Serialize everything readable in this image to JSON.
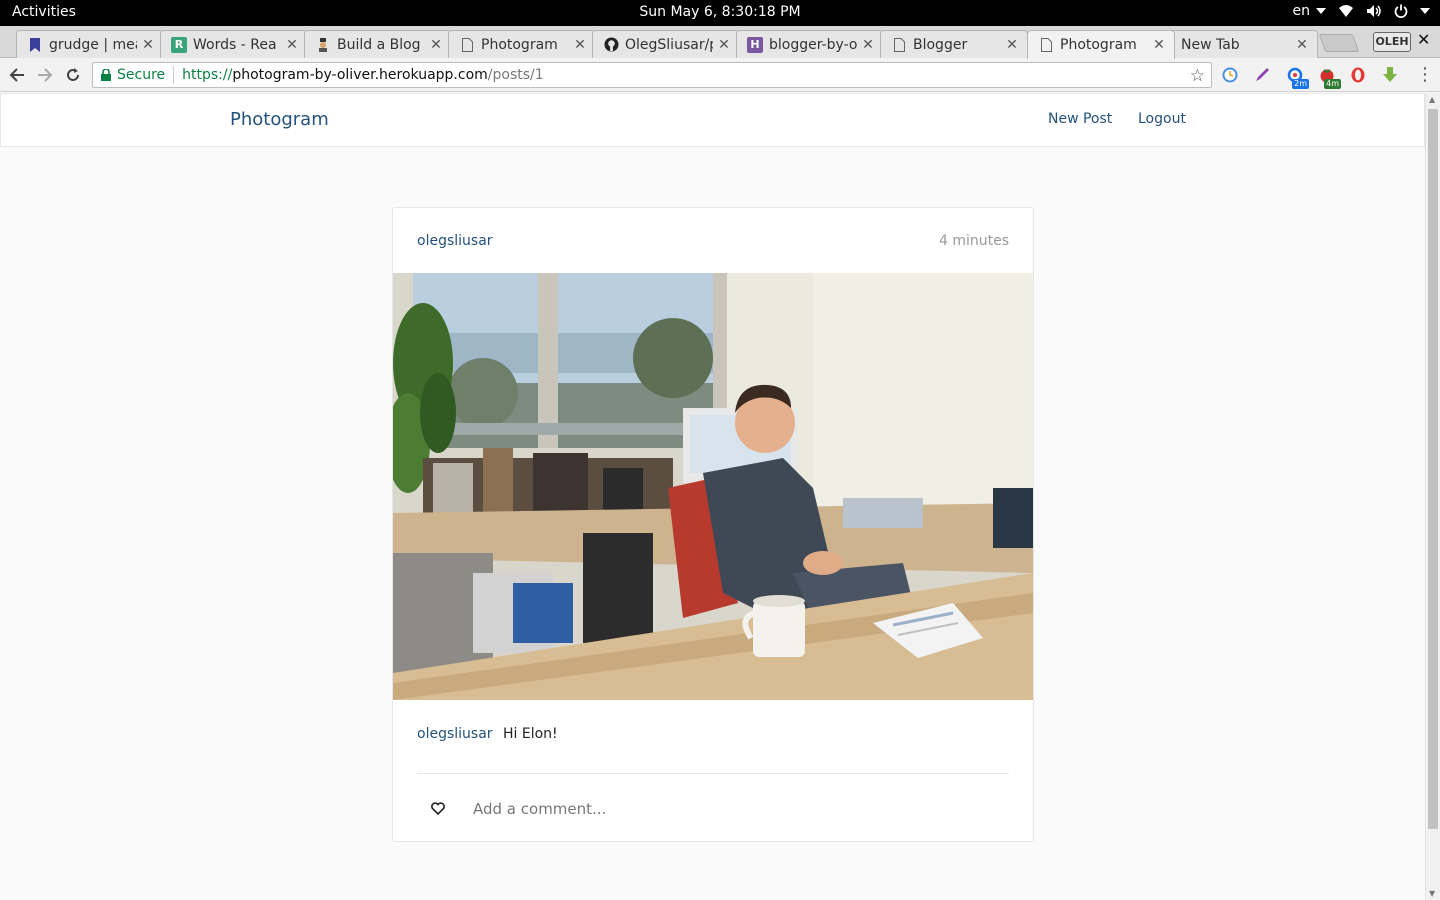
{
  "system_bar": {
    "activities": "Activities",
    "clock": "Sun May  6,  8:30:18 PM",
    "language": "en"
  },
  "browser": {
    "tabs": [
      {
        "title": "grudge | mea",
        "icon": "bookmark-icon",
        "active": false
      },
      {
        "title": "Words - Rea",
        "icon": "r-logo-icon",
        "active": false
      },
      {
        "title": "Build a Blog ",
        "icon": "gentleman-icon",
        "active": false
      },
      {
        "title": "Photogram",
        "icon": "page-icon",
        "active": false
      },
      {
        "title": "OlegSliusar/p",
        "icon": "github-icon",
        "active": false
      },
      {
        "title": "blogger-by-o",
        "icon": "heroku-icon",
        "active": false
      },
      {
        "title": "Blogger",
        "icon": "page-icon",
        "active": false
      },
      {
        "title": "Photogram",
        "icon": "page-icon",
        "active": true
      },
      {
        "title": "New Tab",
        "icon": "none",
        "active": false
      }
    ],
    "profile_label": "OLEH",
    "address": {
      "secure_label": "Secure",
      "scheme": "https://",
      "host": "photogram-by-oliver.herokuapp.com",
      "path": "/posts/1"
    },
    "extension_badges": {
      "ext3": "2m",
      "ext4": "4m"
    }
  },
  "site": {
    "brand": "Photogram",
    "nav": {
      "new_post": "New Post",
      "logout": "Logout"
    }
  },
  "post": {
    "author": "olegsliusar",
    "time_ago": "4 minutes",
    "caption_user": "olegsliusar",
    "caption_text": "Hi Elon!",
    "comment_placeholder": "Add a comment..."
  },
  "colors": {
    "link": "#23527c",
    "muted": "#999999",
    "page_bg": "#fafafa",
    "secure_green": "#0b8043"
  }
}
